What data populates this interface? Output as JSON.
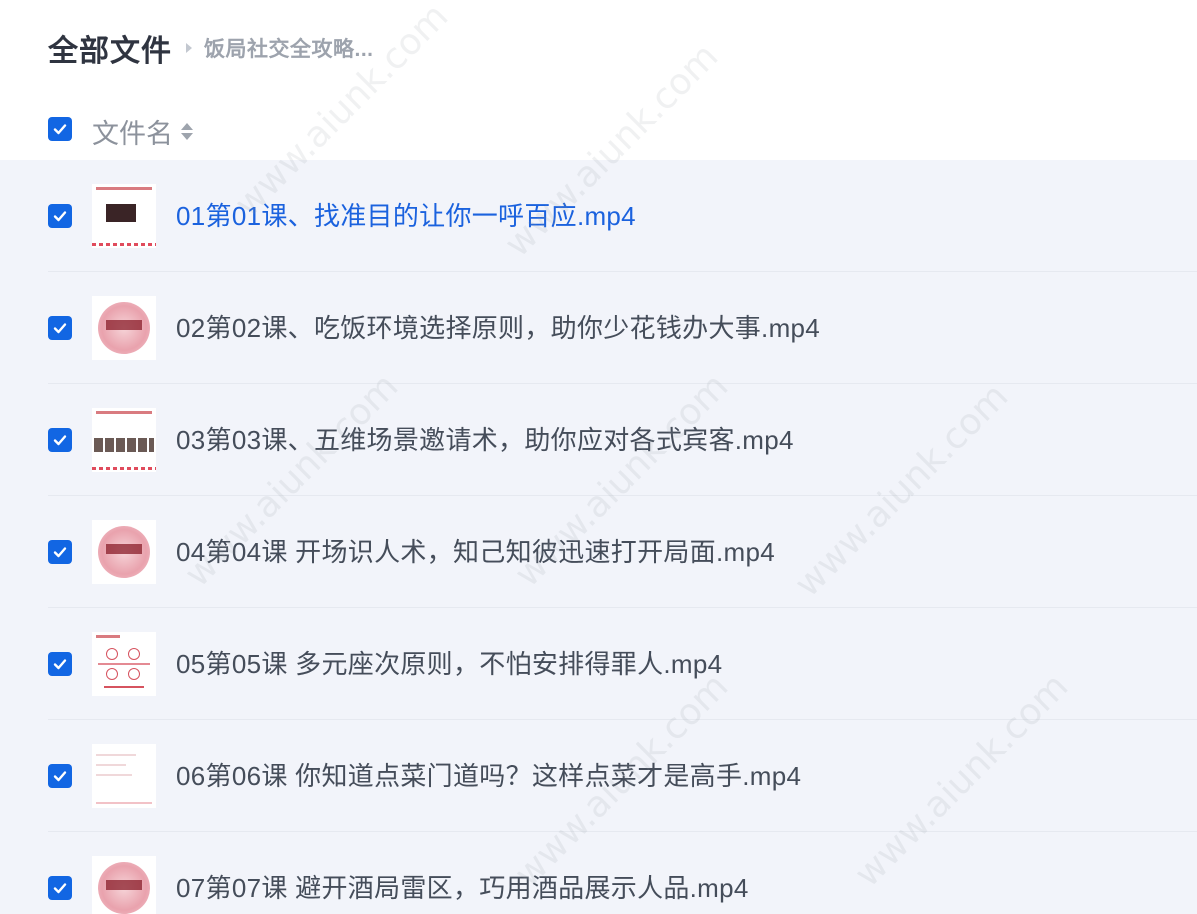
{
  "breadcrumb": {
    "root": "全部文件",
    "current": "饭局社交全攻略..."
  },
  "header": {
    "select_all_checked": true,
    "column_name": "文件名",
    "sort_icon": "sort-updown-icon"
  },
  "files": [
    {
      "name": "01第01课、找准目的让你一呼百应.mp4",
      "checked": true,
      "active": true,
      "thumb": "slide-dark-photo"
    },
    {
      "name": "02第02课、吃饭环境选择原则，助你少花钱办大事.mp4",
      "checked": true,
      "active": false,
      "thumb": "slide-pink-circle"
    },
    {
      "name": "03第03课、五维场景邀请术，助你应对各式宾客.mp4",
      "checked": true,
      "active": false,
      "thumb": "slide-photos"
    },
    {
      "name": "04第04课 开场识人术，知己知彼迅速打开局面.mp4",
      "checked": true,
      "active": false,
      "thumb": "slide-pink-circle"
    },
    {
      "name": "05第05课 多元座次原则，不怕安排得罪人.mp4",
      "checked": true,
      "active": false,
      "thumb": "slide-diagram"
    },
    {
      "name": "06第06课 你知道点菜门道吗？这样点菜才是高手.mp4",
      "checked": true,
      "active": false,
      "thumb": "slide-blank"
    },
    {
      "name": "07第07课 避开酒局雷区，巧用酒品展示人品.mp4",
      "checked": true,
      "active": false,
      "thumb": "slide-pink-circle"
    }
  ],
  "watermark": "www.aiunk.com",
  "colors": {
    "checkbox": "#1266e3",
    "active_link": "#1b62de",
    "list_bg": "#f2f4fa"
  }
}
